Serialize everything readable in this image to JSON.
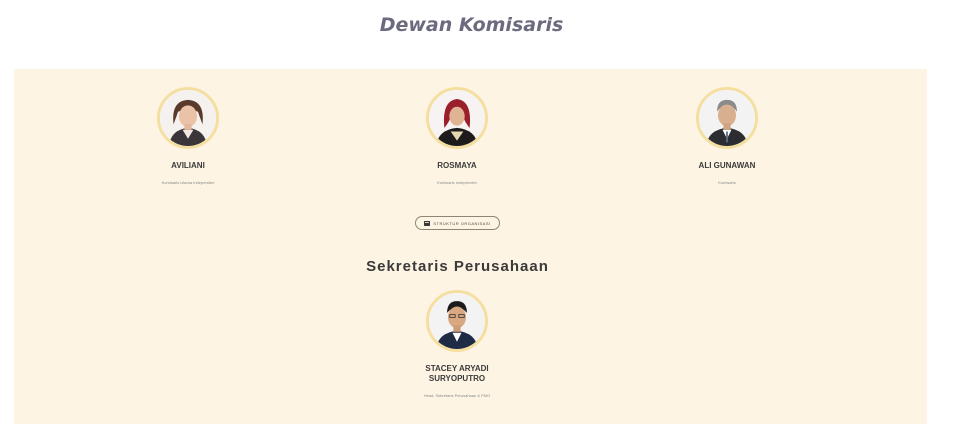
{
  "page": {
    "title": "Dewan Komisaris"
  },
  "commissioners": [
    {
      "name": "AVILIANI",
      "role": "Komisaris Utama Independen"
    },
    {
      "name": "ROSMAYA",
      "role": "Komisaris Independen"
    },
    {
      "name": "ALI GUNAWAN",
      "role": "Komisaris"
    }
  ],
  "org_button": {
    "label": "STRUKTUR ORGANISASI",
    "icon": "org-chart-icon"
  },
  "secretary": {
    "section_title": "Sekretaris Perusahaan",
    "name_line1": "STACEY ARYADI",
    "name_line2": "SURYOPUTRO",
    "role": "Head, Sekretaris Perusahaan & PMO"
  },
  "colors": {
    "panel_background": "#fdf4e3",
    "avatar_ring": "#f5dfa0",
    "title_color": "#6b6a7e"
  }
}
